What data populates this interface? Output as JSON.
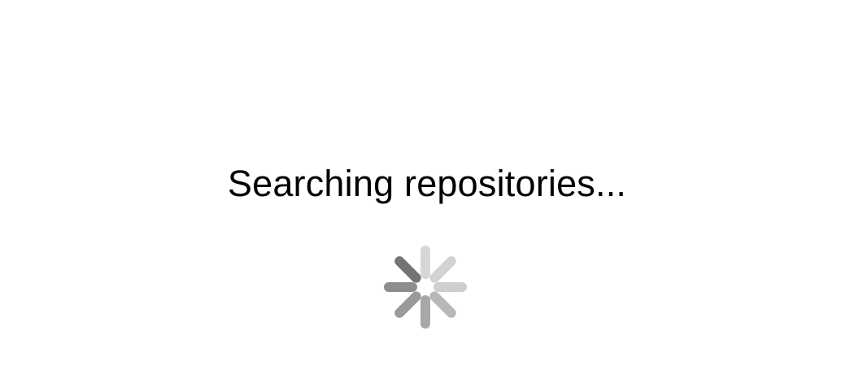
{
  "loading": {
    "message": "Searching repositories..."
  },
  "spinner": {
    "icon": "activity-indicator-icon",
    "spoke_colors": [
      "#d6d6d6",
      "#d2d2d2",
      "#cecece",
      "#b8b8b8",
      "#a8a8a8",
      "#9a9a9a",
      "#8d8d8d",
      "#747474"
    ]
  }
}
